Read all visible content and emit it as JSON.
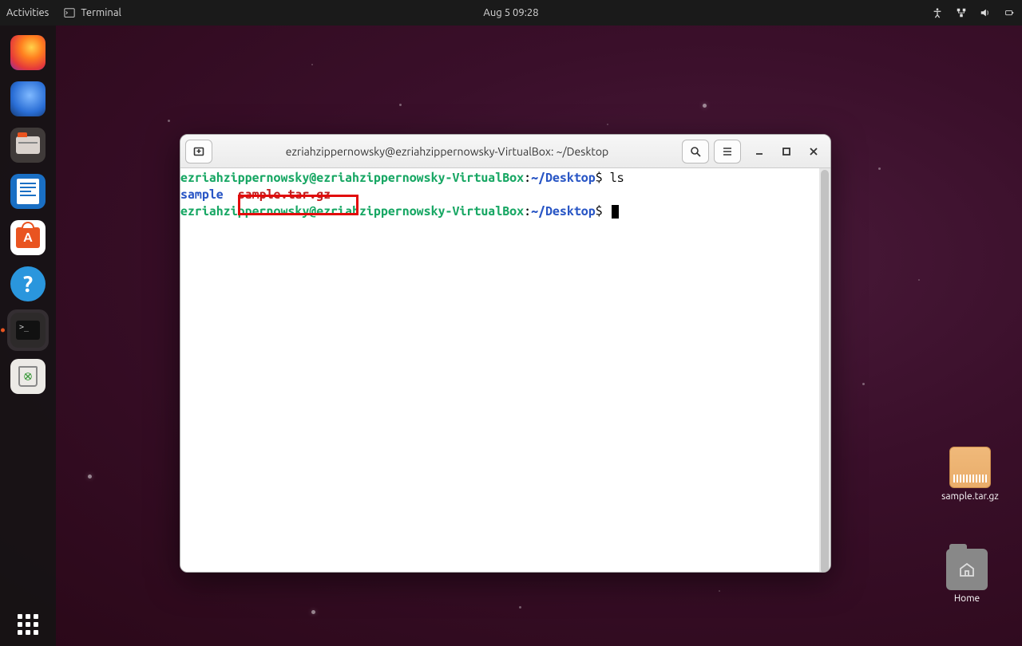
{
  "topbar": {
    "activities_label": "Activities",
    "app_label": "Terminal",
    "clock": "Aug 5  09:28"
  },
  "dock": {
    "items": [
      "firefox",
      "thunderbird",
      "files",
      "writer",
      "software",
      "help",
      "terminal",
      "trash"
    ]
  },
  "desktop": {
    "archive_label": "sample.tar.gz",
    "home_label": "Home"
  },
  "terminal": {
    "title": "ezriahzippernowsky@ezriahzippernowsky-VirtualBox: ~/Desktop",
    "prompt_user": "ezriahzippernowsky@ezriahzippernowsky-VirtualBox",
    "prompt_sep": ":",
    "prompt_path": "~/Desktop",
    "prompt_dollar": "$",
    "command1": "ls",
    "ls_dir": "sample",
    "ls_archive": "sample.tar.gz"
  }
}
